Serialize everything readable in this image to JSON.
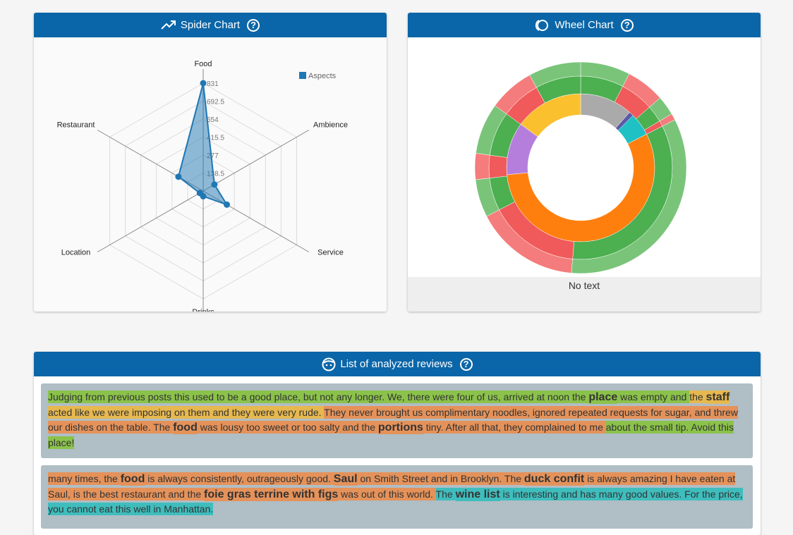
{
  "spider_card": {
    "title": "Spider Chart",
    "help": "?",
    "chart_data": {
      "type": "radar",
      "axes": [
        "Food",
        "Ambience",
        "Service",
        "Drinks",
        "Location",
        "Restaurant"
      ],
      "series": [
        {
          "name": "Aspects",
          "values": [
            831,
            100,
            210,
            40,
            30,
            220
          ]
        }
      ],
      "rlim": [
        0,
        831
      ],
      "ticks": [
        "138.5",
        "277",
        "415.5",
        "554",
        "692.5",
        "831"
      ],
      "legend": "top-right",
      "color": "#1f77b4"
    }
  },
  "wheel_card": {
    "title": "Wheel Chart",
    "help": "?",
    "footer_text": "No text",
    "chart_data": {
      "type": "sunburst",
      "rings": [
        [
          {
            "value": 0.115,
            "color": "#aaaaaa"
          },
          {
            "value": 0.01,
            "color": "#5a5aa8"
          },
          {
            "value": 0.05,
            "color": "#1fc1c4"
          },
          {
            "value": 0.56,
            "color": "#ff7f0e"
          },
          {
            "value": 0.115,
            "color": "#b57edc"
          },
          {
            "value": 0.15,
            "color": "#fbc02d"
          }
        ],
        [
          {
            "value": 0.076,
            "color": "#4caf50"
          },
          {
            "value": 0.059,
            "color": "#f05a5a"
          },
          {
            "value": 0.03,
            "color": "#4caf50"
          },
          {
            "value": 0.01,
            "color": "#f05a5a"
          },
          {
            "value": 0.339,
            "color": "#4caf50"
          },
          {
            "value": 0.16,
            "color": "#f05a5a"
          },
          {
            "value": 0.058,
            "color": "#4caf50"
          },
          {
            "value": 0.04,
            "color": "#f05a5a"
          },
          {
            "value": 0.078,
            "color": "#4caf50"
          },
          {
            "value": 0.07,
            "color": "#f05a5a"
          },
          {
            "value": 0.08,
            "color": "#4caf50"
          }
        ],
        [
          {
            "value": 0.076,
            "color": "#7ac47a"
          },
          {
            "value": 0.059,
            "color": "#f57c7c"
          },
          {
            "value": 0.03,
            "color": "#7ac47a"
          },
          {
            "value": 0.01,
            "color": "#f57c7c"
          },
          {
            "value": 0.339,
            "color": "#7ac47a"
          },
          {
            "value": 0.16,
            "color": "#f57c7c"
          },
          {
            "value": 0.058,
            "color": "#7ac47a"
          },
          {
            "value": 0.04,
            "color": "#f57c7c"
          },
          {
            "value": 0.078,
            "color": "#7ac47a"
          },
          {
            "value": 0.07,
            "color": "#f57c7c"
          },
          {
            "value": 0.08,
            "color": "#7ac47a"
          }
        ]
      ]
    }
  },
  "reviews_card": {
    "title": "List of analyzed reviews",
    "help": "?",
    "reviews": [
      {
        "segments": [
          {
            "text": "Judging from previous posts this used to be a good place, but not any longer. We, there were four of us, arrived at noon the ",
            "cls": "g"
          },
          {
            "text": "place",
            "cls": "g b"
          },
          {
            "text": " was empty and ",
            "cls": "g"
          },
          {
            "text": "the ",
            "cls": "y"
          },
          {
            "text": "staff",
            "cls": "y b"
          },
          {
            "text": " acted like we were imposing on them and they were very rude. ",
            "cls": "y"
          },
          {
            "text": "They never brought us complimentary noodles, ignored repeated requests for sugar, and threw our dishes on the table. The ",
            "cls": "o"
          },
          {
            "text": "food",
            "cls": "o b"
          },
          {
            "text": " was lousy too sweet or too salty and the ",
            "cls": "o"
          },
          {
            "text": "portions",
            "cls": "o b"
          },
          {
            "text": " tiny. After all that, they complained to me ",
            "cls": "o"
          },
          {
            "text": "about the small tip. Avoid this place!",
            "cls": "g"
          }
        ]
      },
      {
        "segments": [
          {
            "text": "many times, the ",
            "cls": "o"
          },
          {
            "text": "food",
            "cls": "o b"
          },
          {
            "text": " is always consistently, outrageously good. ",
            "cls": "o"
          },
          {
            "text": "Saul",
            "cls": "o b"
          },
          {
            "text": " on Smith Street and in Brooklyn. The ",
            "cls": "o"
          },
          {
            "text": "duck confit",
            "cls": "o b"
          },
          {
            "text": " is always amazing I have eaten at Saul, is the best restaurant and the ",
            "cls": "o"
          },
          {
            "text": "foie gras terrine with figs",
            "cls": "o b"
          },
          {
            "text": " was out of this world. ",
            "cls": "o"
          },
          {
            "text": "The ",
            "cls": "t"
          },
          {
            "text": "wine list",
            "cls": "t b"
          },
          {
            "text": " is interesting and has many good values. For the price, you cannot eat this well in Manhattan.",
            "cls": "t"
          }
        ]
      }
    ]
  }
}
